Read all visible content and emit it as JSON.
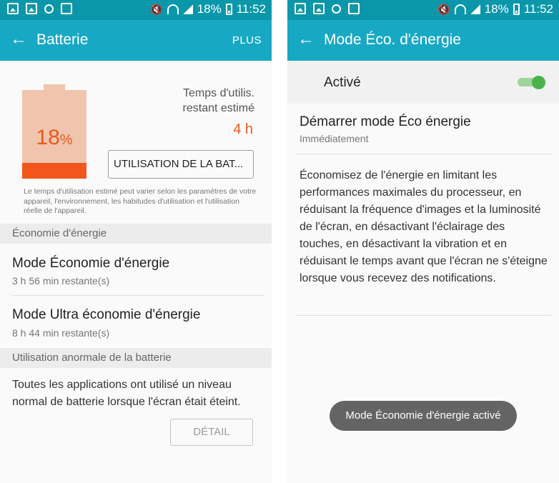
{
  "status_bar": {
    "battery_percent": "18%",
    "time": "11:52"
  },
  "left": {
    "app_bar": {
      "title": "Batterie",
      "action": "PLUS"
    },
    "battery": {
      "percent_number": "18",
      "percent_symbol": "%",
      "level": 18,
      "fill_color": "#f2561a",
      "empty_color": "#f1c4ad"
    },
    "time_label_line1": "Temps d'utilis.",
    "time_label_line2": "restant estimé",
    "time_value": "4 h",
    "usage_button": "UTILISATION DE LA BAT...",
    "note": "Le temps d'utilisation estimé peut varier selon les paramètres de votre appareil, l'environnement, les habitudes d'utilisation et l'utilisation réelle de l'appareil.",
    "section_energy": "Économie d'énergie",
    "item_mode": {
      "title": "Mode Économie d'énergie",
      "subtitle": "3 h 56 min restante(s)"
    },
    "item_ultra": {
      "title": "Mode Ultra économie d'énergie",
      "subtitle": "8 h 44 min restante(s)"
    },
    "section_abnormal": "Utilisation anormale de la batterie",
    "abnormal_text": "Toutes les applications ont utilisé un niveau normal de batterie lorsque l'écran était éteint.",
    "detail_button": "DÉTAIL"
  },
  "right": {
    "app_bar": {
      "title": "Mode Éco. d'énergie"
    },
    "active_label": "Activé",
    "switch_on": true,
    "start": {
      "title": "Démarrer mode Éco énergie",
      "subtitle": "Immédiatement"
    },
    "description": "Économisez de l'énergie en limitant les performances maximales du processeur, en réduisant la fréquence d'images et la luminosité de l'écran, en désactivant l'éclairage des touches, en désactivant la vibration et en réduisant le temps avant que l'écran ne s'éteigne lorsque vous recevez des notifications.",
    "toast": "Mode Économie d'énergie activé"
  },
  "colors": {
    "status_bar": "#0b97aa",
    "app_bar": "#17a8c4",
    "accent_orange": "#e85a1c",
    "switch_green": "#4cb24c"
  }
}
